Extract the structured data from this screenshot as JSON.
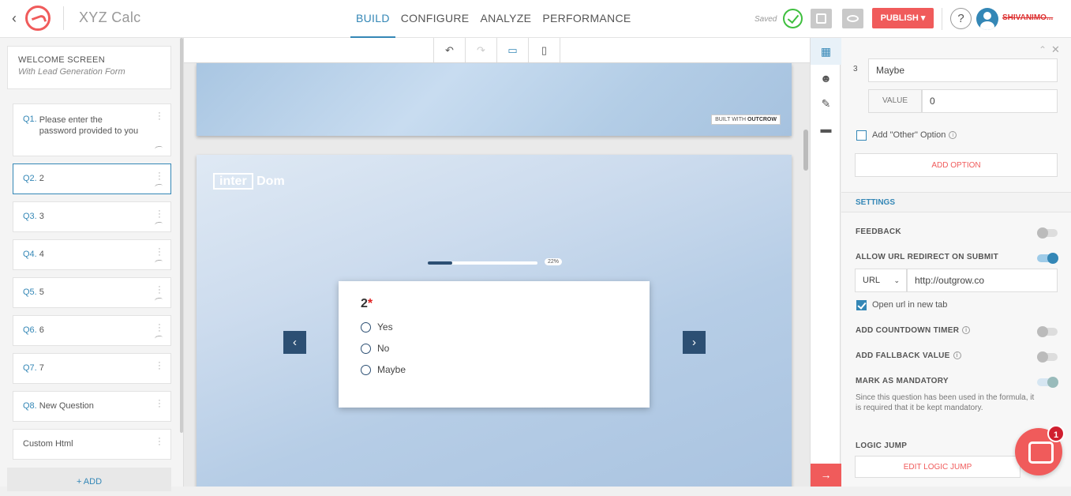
{
  "header": {
    "app_name": "XYZ Calc",
    "tabs": [
      "BUILD",
      "CONFIGURE",
      "ANALYZE",
      "PERFORMANCE"
    ],
    "active_tab": "BUILD",
    "saved_label": "Saved",
    "publish_label": "PUBLISH ▾",
    "help_label": "?",
    "username": "SHIVANIMO..."
  },
  "sidebar": {
    "welcome_title": "WELCOME SCREEN",
    "welcome_subtitle": "With Lead Generation Form",
    "questions": [
      {
        "num": "Q1.",
        "text": "Please enter the password provided to you"
      },
      {
        "num": "Q2.",
        "text": "2"
      },
      {
        "num": "Q3.",
        "text": "3"
      },
      {
        "num": "Q4.",
        "text": "4"
      },
      {
        "num": "Q5.",
        "text": "5"
      },
      {
        "num": "Q6.",
        "text": "6"
      },
      {
        "num": "Q7.",
        "text": "7"
      },
      {
        "num": "Q8.",
        "text": "New Question"
      },
      {
        "num": "",
        "text": "Custom Html"
      }
    ],
    "add_label": "+ ADD"
  },
  "preview": {
    "built_with": "BUILT WITH",
    "built_brand": "OUTCROW",
    "brand_left": "inter",
    "brand_right": "Dom",
    "progress_percent": 22,
    "progress_label": "22%",
    "question_title": "2",
    "required_mark": "*",
    "options": [
      "Yes",
      "No",
      "Maybe"
    ],
    "prev_arrow": "‹",
    "next_arrow": "›"
  },
  "toolbar": {
    "undo": "↶",
    "redo": "↷",
    "desktop": "▭",
    "mobile": "▯"
  },
  "right_panel": {
    "option_index": "3",
    "option_value": "Maybe",
    "value_label": "VALUE",
    "value_input": "0",
    "other_option_label": "Add \"Other\" Option",
    "add_option_label": "ADD OPTION",
    "settings_header": "SETTINGS",
    "feedback_label": "FEEDBACK",
    "url_redirect_label": "ALLOW URL REDIRECT ON SUBMIT",
    "url_type": "URL",
    "url_value": "http://outgrow.co",
    "open_new_tab_label": "Open url in new tab",
    "countdown_label": "ADD COUNTDOWN TIMER",
    "fallback_label": "ADD FALLBACK VALUE",
    "mandatory_label": "MARK AS MANDATORY",
    "mandatory_note": "Since this question has been used in the formula, it is required that it be kept mandatory.",
    "logic_jump_label": "LOGIC JUMP",
    "edit_logic_label": "EDIT LOGIC JUMP"
  },
  "chat": {
    "badge_count": "1"
  },
  "colors": {
    "accent": "#3487b6",
    "publish": "#f05b5b",
    "dark_nav": "#2c4f73"
  }
}
